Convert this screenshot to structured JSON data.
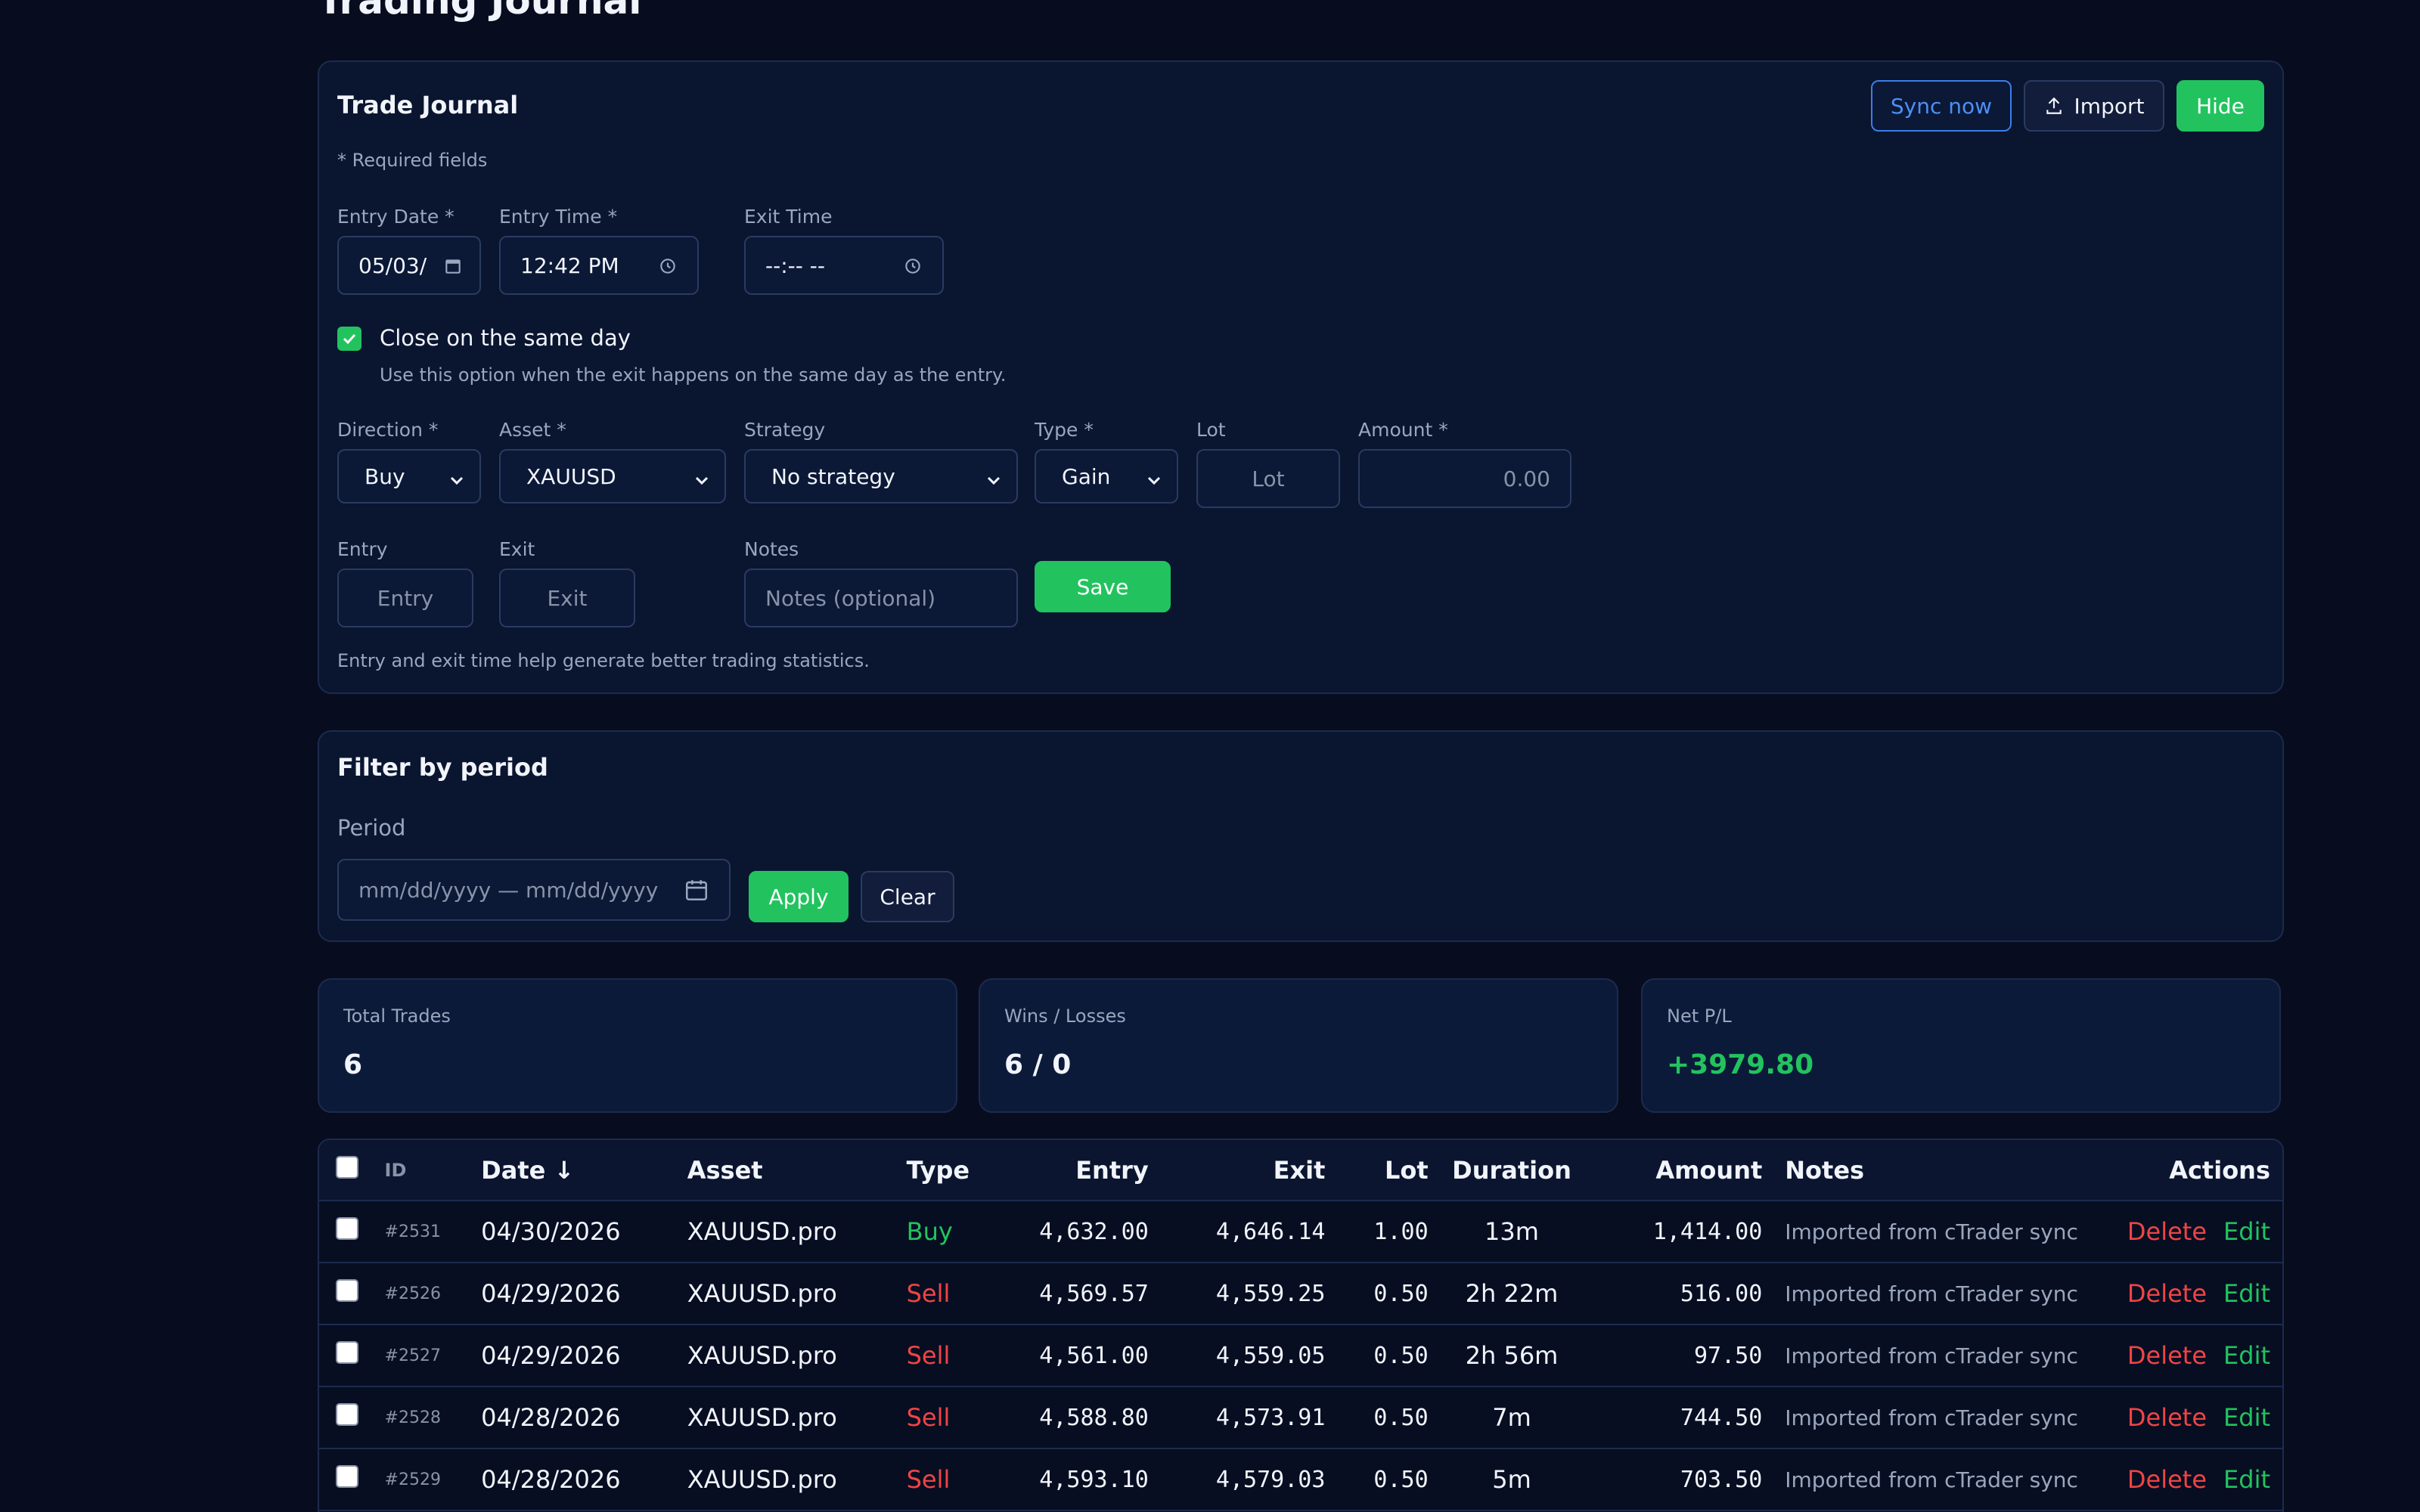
{
  "page": {
    "title": "Trading Journal"
  },
  "journal_form": {
    "title": "Trade Journal",
    "required_note": "* Required fields",
    "sync_label": "Sync now",
    "import_label": "Import",
    "hide_label": "Hide",
    "entry_date": {
      "label": "Entry Date *",
      "value": "05/03/"
    },
    "entry_time": {
      "label": "Entry Time *",
      "value": "12:42 PM"
    },
    "exit_time": {
      "label": "Exit Time",
      "value": "--:-- --"
    },
    "same_day": {
      "label": "Close on the same day",
      "hint": "Use this option when the exit happens on the same day as the entry.",
      "checked": true
    },
    "direction": {
      "label": "Direction *",
      "value": "Buy"
    },
    "asset": {
      "label": "Asset *",
      "value": "XAUUSD"
    },
    "strategy": {
      "label": "Strategy",
      "value": "No strategy"
    },
    "type": {
      "label": "Type *",
      "value": "Gain"
    },
    "lot": {
      "label": "Lot",
      "placeholder": "Lot"
    },
    "amount": {
      "label": "Amount *",
      "placeholder": "0.00"
    },
    "entry": {
      "label": "Entry",
      "placeholder": "Entry"
    },
    "exit": {
      "label": "Exit",
      "placeholder": "Exit"
    },
    "notes": {
      "label": "Notes",
      "placeholder": "Notes (optional)"
    },
    "save_label": "Save",
    "footer_hint": "Entry and exit time help generate better trading statistics."
  },
  "filter": {
    "title": "Filter by period",
    "period_label": "Period",
    "placeholder": "mm/dd/yyyy — mm/dd/yyyy",
    "apply_label": "Apply",
    "clear_label": "Clear"
  },
  "stats": {
    "total_trades": {
      "label": "Total Trades",
      "value": "6"
    },
    "wins_losses": {
      "label": "Wins / Losses",
      "value": "6 / 0"
    },
    "net_pl": {
      "label": "Net P/L",
      "value": "+3979.80"
    }
  },
  "table": {
    "headers": {
      "id": "ID",
      "date": "Date ↓",
      "asset": "Asset",
      "type": "Type",
      "entry": "Entry",
      "exit": "Exit",
      "lot": "Lot",
      "duration": "Duration",
      "amount": "Amount",
      "notes": "Notes",
      "actions": "Actions"
    },
    "edit_label": "Edit",
    "delete_label": "Delete",
    "rows": [
      {
        "id": "#2531",
        "date": "04/30/2026",
        "asset": "XAUUSD.pro",
        "type": "Buy",
        "entry": "4,632.00",
        "exit": "4,646.14",
        "lot": "1.00",
        "duration": "13m",
        "amount": "1,414.00",
        "notes": "Imported from cTrader sync"
      },
      {
        "id": "#2526",
        "date": "04/29/2026",
        "asset": "XAUUSD.pro",
        "type": "Sell",
        "entry": "4,569.57",
        "exit": "4,559.25",
        "lot": "0.50",
        "duration": "2h 22m",
        "amount": "516.00",
        "notes": "Imported from cTrader sync"
      },
      {
        "id": "#2527",
        "date": "04/29/2026",
        "asset": "XAUUSD.pro",
        "type": "Sell",
        "entry": "4,561.00",
        "exit": "4,559.05",
        "lot": "0.50",
        "duration": "2h 56m",
        "amount": "97.50",
        "notes": "Imported from cTrader sync"
      },
      {
        "id": "#2528",
        "date": "04/28/2026",
        "asset": "XAUUSD.pro",
        "type": "Sell",
        "entry": "4,588.80",
        "exit": "4,573.91",
        "lot": "0.50",
        "duration": "7m",
        "amount": "744.50",
        "notes": "Imported from cTrader sync"
      },
      {
        "id": "#2529",
        "date": "04/28/2026",
        "asset": "XAUUSD.pro",
        "type": "Sell",
        "entry": "4,593.10",
        "exit": "4,579.03",
        "lot": "0.50",
        "duration": "5m",
        "amount": "703.50",
        "notes": "Imported from cTrader sync"
      }
    ]
  },
  "colors": {
    "accent_green": "#22c35e",
    "danger_red": "#ef4444",
    "link_blue": "#4d8ff5",
    "background": "#070d1f"
  }
}
